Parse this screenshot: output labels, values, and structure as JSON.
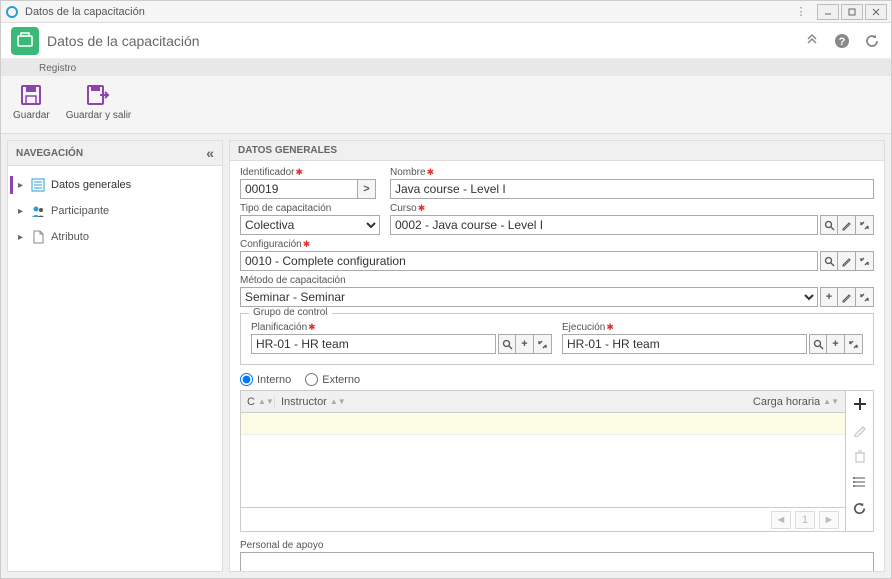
{
  "window": {
    "title": "Datos de la capacitación"
  },
  "header": {
    "title": "Datos de la capacitación"
  },
  "ribbon": {
    "tab": "Registro",
    "save": "Guardar",
    "save_exit": "Guardar y salir"
  },
  "nav": {
    "title": "NAVEGACIÓN",
    "items": [
      {
        "label": "Datos generales"
      },
      {
        "label": "Participante"
      },
      {
        "label": "Atributo"
      }
    ]
  },
  "section": {
    "title": "DATOS GENERALES"
  },
  "form": {
    "identificador": {
      "label": "Identificador",
      "value": "00019"
    },
    "nombre": {
      "label": "Nombre",
      "value": "Java course - Level I"
    },
    "tipo": {
      "label": "Tipo de capacitación",
      "value": "Colectiva"
    },
    "curso": {
      "label": "Curso",
      "value": "0002 - Java course - Level I"
    },
    "config": {
      "label": "Configuración",
      "value": "0010 - Complete configuration"
    },
    "metodo": {
      "label": "Método de capacitación",
      "value": "Seminar - Seminar"
    },
    "grupo": {
      "legend": "Grupo de control",
      "planif": {
        "label": "Planificación",
        "value": "HR-01 - HR team"
      },
      "ejec": {
        "label": "Ejecución",
        "value": "HR-01 - HR team"
      }
    },
    "interno": "Interno",
    "externo": "Externo",
    "table": {
      "c": "C",
      "instructor": "Instructor",
      "carga": "Carga horaria"
    },
    "pager": {
      "page": "1"
    },
    "personal": {
      "label": "Personal de apoyo",
      "value": ""
    }
  }
}
